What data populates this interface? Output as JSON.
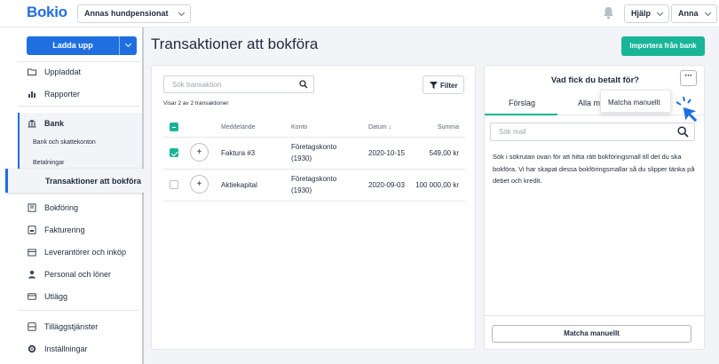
{
  "header": {
    "logo": "Bokio",
    "organization": "Annas hundpensionat",
    "help": "Hjälp",
    "user": "Anna"
  },
  "sidebar": {
    "upload_label": "Ladda upp",
    "items": [
      {
        "label": "Uppladdat",
        "icon": "folder-icon"
      },
      {
        "label": "Rapporter",
        "icon": "bar-chart-icon"
      },
      {
        "label": "Bank",
        "icon": "bank-icon"
      },
      {
        "label": "Bokföring",
        "icon": "ledger-icon"
      },
      {
        "label": "Fakturering",
        "icon": "invoice-icon"
      },
      {
        "label": "Leverantörer och inköp",
        "icon": "supplier-icon"
      },
      {
        "label": "Personal och löner",
        "icon": "person-icon"
      },
      {
        "label": "Utlägg",
        "icon": "card-icon"
      },
      {
        "label": "Tilläggstjänster",
        "icon": "addon-icon"
      },
      {
        "label": "Inställningar",
        "icon": "gear-icon"
      }
    ],
    "bank_sub": [
      "Bank och skattekonton",
      "Betalningar"
    ],
    "active": "Transaktioner att bokföra"
  },
  "main": {
    "title": "Transaktioner att bokföra",
    "import_label": "Importera från bank",
    "search_placeholder": "Sök transaktion",
    "filter_label": "Filter",
    "count_text": "Visar 2 av 2 transaktioner",
    "columns": {
      "message": "Meddelande",
      "account": "Konto",
      "date": "Datum",
      "amount": "Summa"
    },
    "rows": [
      {
        "checked": true,
        "message": "Faktura #3",
        "account_line1": "Företagskonto",
        "account_line2": "(1930)",
        "date": "2020-10-15",
        "amount": "549,00 kr"
      },
      {
        "checked": false,
        "message": "Aktiekapital",
        "account_line1": "Företagskonto",
        "account_line2": "(1930)",
        "date": "2020-09-03",
        "amount": "100 000,00 kr"
      }
    ]
  },
  "panel": {
    "title": "Vad fick du betalt för?",
    "more_label": "···",
    "tabs": [
      "Förslag",
      "Alla ma"
    ],
    "dropdown_item": "Matcha manuellt",
    "search_placeholder": "Sök mall",
    "help_text": "Sök i sökrutan ovan för att hitta rätt bokföringsmall till det du ska bokföra. Vi har skapat dessa bokföringsmallar så du slipper tänka på debet och kredit.",
    "match_button": "Matcha manuellt"
  },
  "colors": {
    "brand_blue": "#1f6fe0",
    "accent_green": "#18b598",
    "background": "#f2f4f7"
  }
}
